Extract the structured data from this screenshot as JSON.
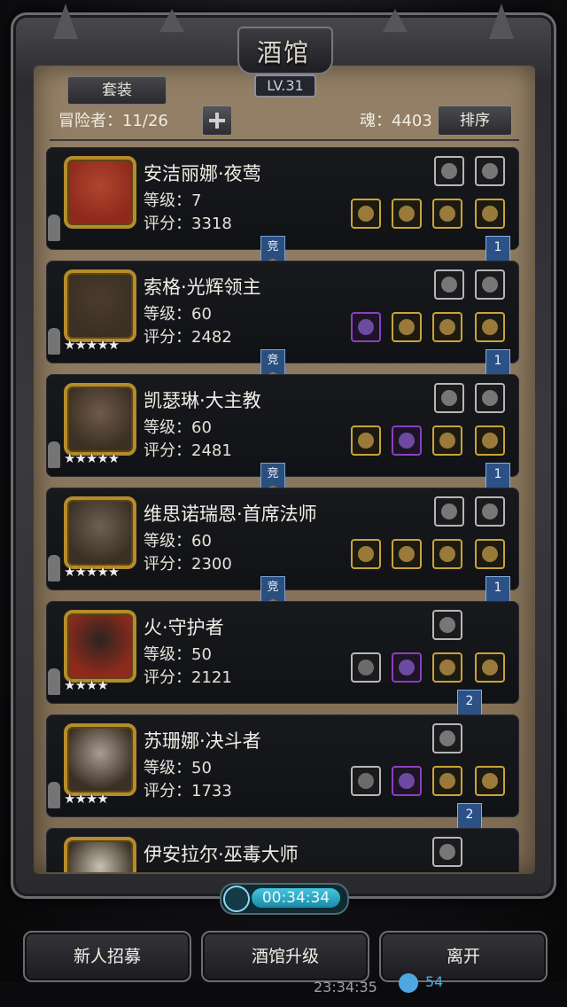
{
  "header": {
    "title": "酒馆",
    "level": "LV.31"
  },
  "toolbar": {
    "set_tab": "套装",
    "adventurers_label": "冒险者：11/26",
    "soul_label": "魂：4403",
    "sort_label": "排序"
  },
  "heroes": [
    {
      "name": "安洁丽娜·夜莺",
      "level": "等级：7",
      "score": "评分：3318",
      "stars": "",
      "badge": "竞",
      "rank": "1",
      "frame": "red",
      "top_items": [
        {
          "icon": "sword-icon",
          "rarity": "gray"
        },
        {
          "icon": "feather-icon",
          "rarity": "gray"
        }
      ],
      "bottom_items": [
        {
          "icon": "staff-icon",
          "rarity": "gold"
        },
        {
          "icon": "cloak-icon",
          "rarity": "gold"
        },
        {
          "icon": "helm-icon",
          "rarity": "gold"
        },
        {
          "icon": "ring-icon",
          "rarity": "gold"
        }
      ]
    },
    {
      "name": "索格·光辉领主",
      "level": "等级：60",
      "score": "评分：2482",
      "stars": "★★★★★",
      "badge": "竞",
      "rank": "1",
      "frame": "gold",
      "top_items": [
        {
          "icon": "emblem-icon",
          "rarity": "gray"
        },
        {
          "icon": "horn-icon",
          "rarity": "gray"
        }
      ],
      "bottom_items": [
        {
          "icon": "hammer-icon",
          "rarity": "purple"
        },
        {
          "icon": "robe-icon",
          "rarity": "gold"
        },
        {
          "icon": "helm-icon",
          "rarity": "gold"
        },
        {
          "icon": "gauntlet-icon",
          "rarity": "gold"
        }
      ]
    },
    {
      "name": "凯瑟琳·大主教",
      "level": "等级：60",
      "score": "评分：2481",
      "stars": "★★★★★",
      "badge": "竞",
      "rank": "1",
      "frame": "gold",
      "top_items": [
        {
          "icon": "glove-icon",
          "rarity": "gray"
        },
        {
          "icon": "amulet-icon",
          "rarity": "gray"
        }
      ],
      "bottom_items": [
        {
          "icon": "axe-icon",
          "rarity": "gold"
        },
        {
          "icon": "cloak-icon",
          "rarity": "purple"
        },
        {
          "icon": "ring-icon",
          "rarity": "gold"
        },
        {
          "icon": "ring-icon",
          "rarity": "gold"
        }
      ]
    },
    {
      "name": "维思诺瑞恩·首席法师",
      "level": "等级：60",
      "score": "评分：2300",
      "stars": "★★★★★",
      "badge": "竞",
      "rank": "1",
      "frame": "gold",
      "top_items": [
        {
          "icon": "book-icon",
          "rarity": "gray"
        },
        {
          "icon": "crystal-icon",
          "rarity": "gray"
        }
      ],
      "bottom_items": [
        {
          "icon": "wand-icon",
          "rarity": "gold"
        },
        {
          "icon": "armor-icon",
          "rarity": "gold"
        },
        {
          "icon": "necklace-icon",
          "rarity": "gold"
        },
        {
          "icon": "potion-icon",
          "rarity": "gold"
        }
      ]
    },
    {
      "name": "火·守护者",
      "level": "等级：50",
      "score": "评分：2121",
      "stars": "★★★★",
      "badge": "",
      "rank": "2",
      "frame": "red",
      "top_items": [
        {
          "icon": "orb-icon",
          "rarity": "gray"
        }
      ],
      "bottom_items": [
        {
          "icon": "blade-icon",
          "rarity": "gray"
        },
        {
          "icon": "armor-icon",
          "rarity": "purple"
        },
        {
          "icon": "ring-icon",
          "rarity": "gold"
        },
        {
          "icon": "ring-icon",
          "rarity": "gold"
        }
      ]
    },
    {
      "name": "苏珊娜·决斗者",
      "level": "等级：50",
      "score": "评分：1733",
      "stars": "★★★★",
      "badge": "",
      "rank": "2",
      "frame": "gold",
      "top_items": [
        {
          "icon": "glove-icon",
          "rarity": "gray"
        }
      ],
      "bottom_items": [
        {
          "icon": "dagger-icon",
          "rarity": "gray"
        },
        {
          "icon": "armor-icon",
          "rarity": "purple"
        },
        {
          "icon": "ring-icon",
          "rarity": "gold"
        },
        {
          "icon": "cape-icon",
          "rarity": "gold"
        }
      ]
    },
    {
      "name": "伊安拉尔·巫毒大师",
      "level": "",
      "score": "",
      "stars": "",
      "badge": "",
      "rank": "",
      "frame": "gold",
      "top_items": [
        {
          "icon": "crystal-icon",
          "rarity": "gray"
        }
      ],
      "bottom_items": []
    }
  ],
  "timer": {
    "value": "00:34:34"
  },
  "buttons": {
    "recruit": "新人招募",
    "upgrade": "酒馆升级",
    "leave": "离开"
  },
  "status_bar": {
    "clock": "23:34:35",
    "gems": "54"
  },
  "colors": {
    "gold_frame": "#c8a43a",
    "purple_frame": "#8c3fc0",
    "gray_frame": "#b7b7b7",
    "accent_blue": "#2c5187"
  }
}
